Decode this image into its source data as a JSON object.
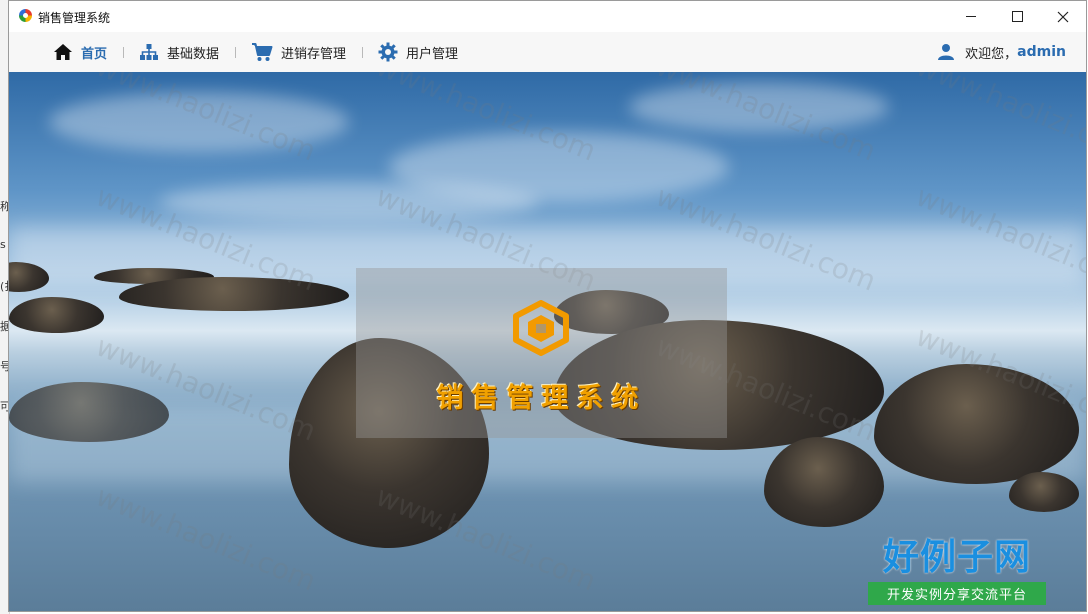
{
  "window": {
    "title": "销售管理系统",
    "controls": {
      "minimize": "minimize",
      "maximize": "maximize",
      "close": "close"
    }
  },
  "nav": {
    "items": [
      {
        "label": "首页",
        "icon": "home-icon",
        "active": true
      },
      {
        "label": "基础数据",
        "icon": "sitemap-icon",
        "active": false
      },
      {
        "label": "进销存管理",
        "icon": "cart-icon",
        "active": false
      },
      {
        "label": "用户管理",
        "icon": "gear-icon",
        "active": false
      }
    ],
    "greeting": "欢迎您，",
    "username": "admin"
  },
  "hero": {
    "system_name": "销售管理系统",
    "logo_icon": "hexagon-logo-icon"
  },
  "watermark": {
    "text": "www.haolizi.com",
    "brand_main": "好例子网",
    "brand_sub": "开发实例分享交流平台"
  },
  "colors": {
    "accent": "#2b6cb0",
    "logo": "#f0a000",
    "brand_blue": "#1a8fe0",
    "brand_green": "#2fa84a"
  },
  "behind_window": {
    "fragments": [
      "称",
      "s",
      "(扌",
      "据",
      "号",
      "可"
    ]
  }
}
